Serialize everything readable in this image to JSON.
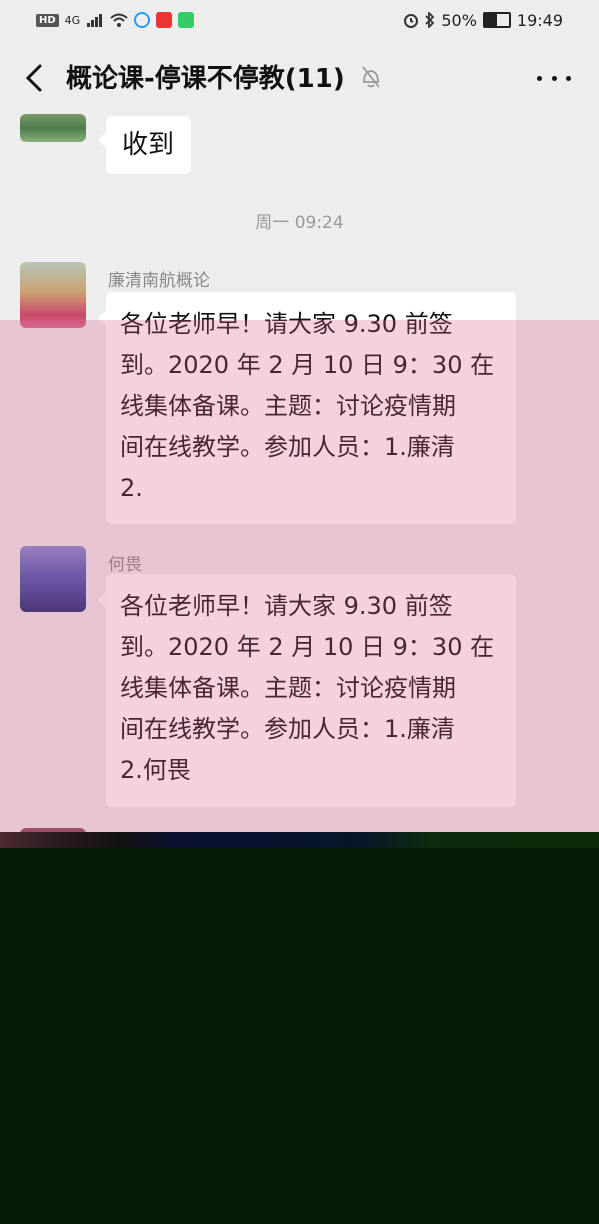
{
  "status_bar": {
    "left_badge": "HD",
    "network": "4G",
    "battery_percent": 50,
    "battery_text": "50%",
    "time": "19:49"
  },
  "header": {
    "title": "概论课-停课不停教(11)"
  },
  "chat": {
    "messages": [
      {
        "text": "收到"
      },
      {
        "timestamp": "周一 09:24"
      },
      {
        "sender": "廉清南航概论",
        "line1": "各位老师早！请大家 9.30 前签",
        "line2": "到。2020 年 2 月 10 日 9：30 在",
        "line3": "线集体备课。主题：讨论疫情期",
        "line4": "间在线教学。参加人员：1.廉清",
        "line5": "2."
      },
      {
        "sender": "何畏",
        "line1": "各位老师早！请大家 9.30 前签",
        "line2": "到。2020 年 2 月 10 日 9：30 在",
        "line3": "线集体备课。主题：讨论疫情期",
        "line4": "间在线教学。参加人员：1.廉清",
        "line5": "2.何畏"
      }
    ]
  },
  "icons": {
    "back": "back-arrow-icon",
    "mute": "bell-off-icon",
    "more": "more-dots-icon",
    "alarm": "alarm-icon",
    "bluetooth": "bluetooth-icon",
    "wifi": "wifi-icon",
    "signal": "signal-icon"
  }
}
